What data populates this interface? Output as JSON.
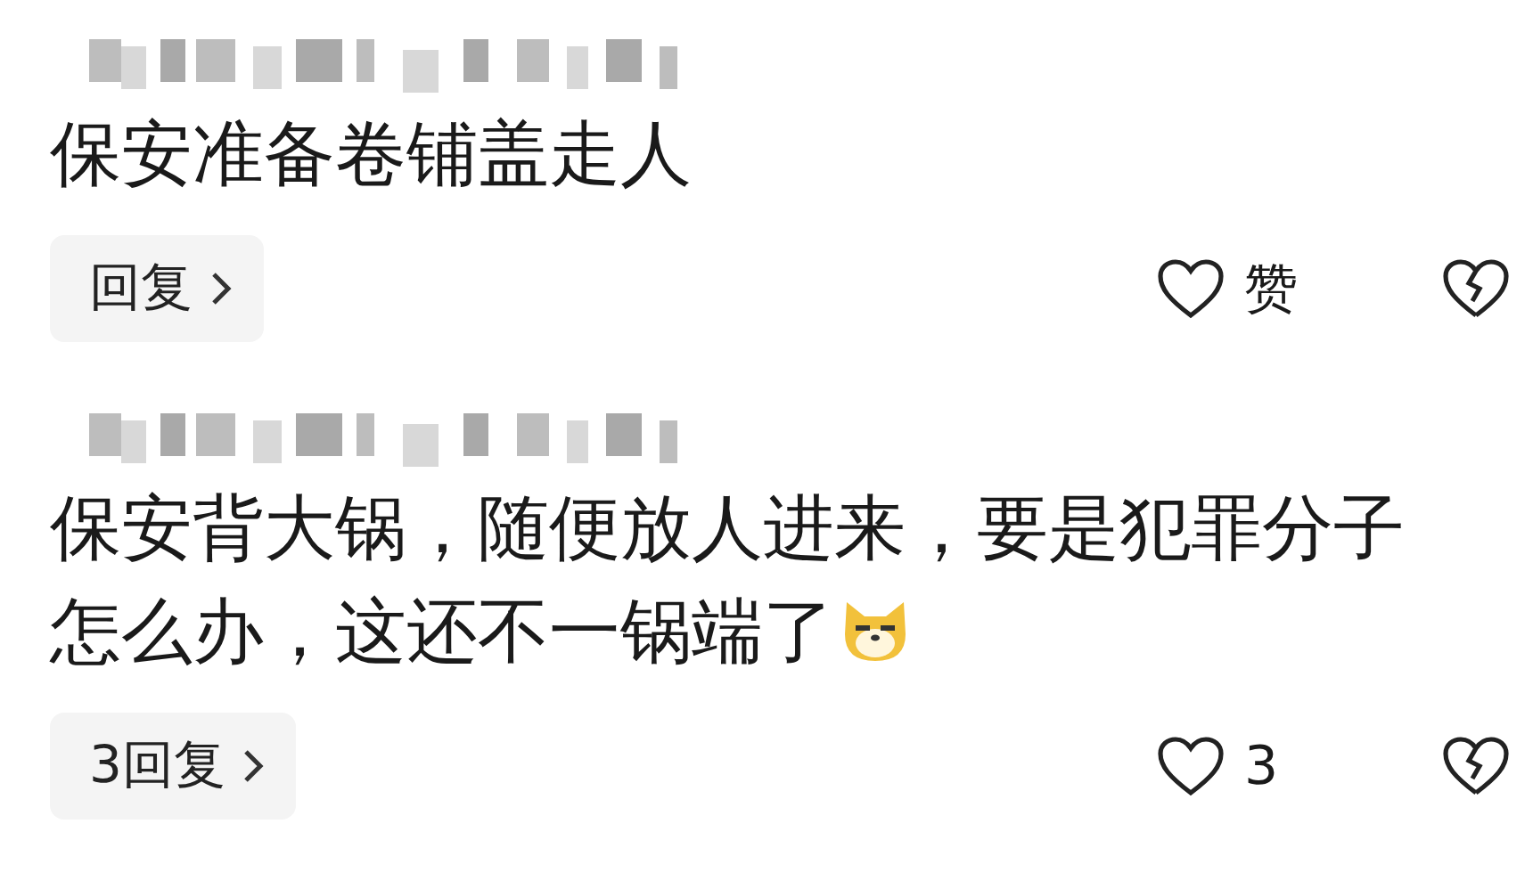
{
  "comments": [
    {
      "text": "保安准备卷铺盖走人",
      "emoji": false,
      "reply_label": "回复",
      "like_label": "赞"
    },
    {
      "text": "保安背大锅，随便放人进来，要是犯罪分子怎么办，这还不一锅端了",
      "emoji": true,
      "reply_label": "3回复",
      "like_label": "3"
    }
  ]
}
